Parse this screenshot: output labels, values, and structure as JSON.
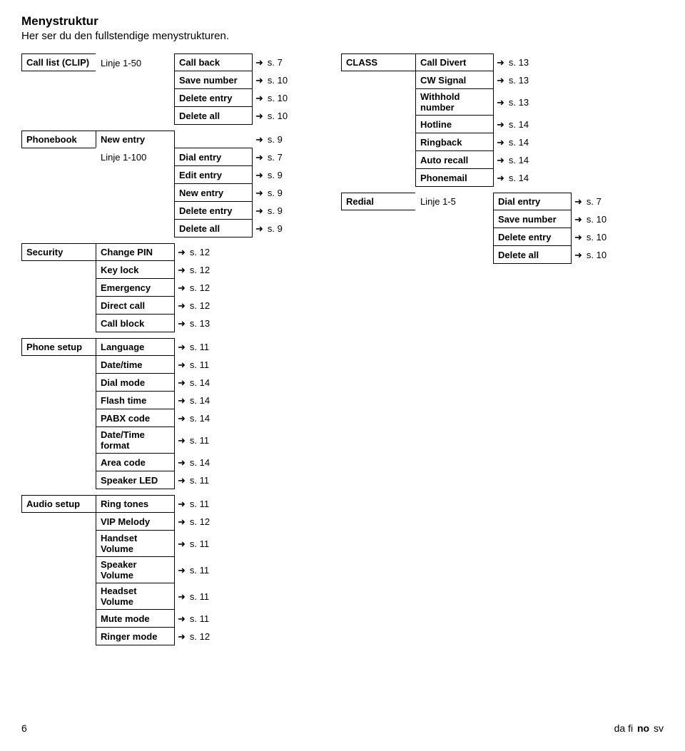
{
  "title": "Menystruktur",
  "subtitle": "Her ser du den fullstendige menystrukturen.",
  "arrow": "➜",
  "footer": {
    "page": "6",
    "lang_da": "da",
    "lang_fi": "fi",
    "lang_no": "no",
    "lang_sv": "sv"
  },
  "callList": {
    "label": "Call list (CLIP)",
    "range": "Linje 1-50",
    "items": [
      {
        "label": "Call back",
        "page": "s. 7"
      },
      {
        "label": "Save number",
        "page": "s. 10"
      },
      {
        "label": "Delete entry",
        "page": "s. 10"
      },
      {
        "label": "Delete all",
        "page": "s. 10"
      }
    ]
  },
  "phonebook": {
    "label": "Phonebook",
    "newEntry": {
      "label": "New entry",
      "page": "s. 9"
    },
    "range": "Linje 1-100",
    "subItems": [
      {
        "label": "Dial entry",
        "page": "s. 7"
      },
      {
        "label": "Edit entry",
        "page": "s. 9"
      },
      {
        "label": "New entry",
        "page": "s. 9"
      },
      {
        "label": "Delete entry",
        "page": "s. 9"
      },
      {
        "label": "Delete all",
        "page": "s. 9"
      }
    ]
  },
  "security": {
    "label": "Security",
    "items": [
      {
        "label": "Change PIN",
        "page": "s. 12"
      },
      {
        "label": "Key lock",
        "page": "s. 12"
      },
      {
        "label": "Emergency",
        "page": "s. 12"
      },
      {
        "label": "Direct call",
        "page": "s. 12"
      },
      {
        "label": "Call block",
        "page": "s. 13"
      }
    ]
  },
  "phoneSetup": {
    "label": "Phone setup",
    "items": [
      {
        "label": "Language",
        "page": "s. 11"
      },
      {
        "label": "Date/time",
        "page": "s. 11"
      },
      {
        "label": "Dial mode",
        "page": "s. 14"
      },
      {
        "label": "Flash time",
        "page": "s. 14"
      },
      {
        "label": "PABX code",
        "page": "s. 14"
      },
      {
        "label": "Date/Time format",
        "page": "s. 11"
      },
      {
        "label": "Area code",
        "page": "s. 14"
      },
      {
        "label": "Speaker LED",
        "page": "s. 11"
      }
    ]
  },
  "audioSetup": {
    "label": "Audio setup",
    "items": [
      {
        "label": "Ring tones",
        "page": "s. 11"
      },
      {
        "label": "VIP Melody",
        "page": "s. 12"
      },
      {
        "label": "Handset Volume",
        "page": "s. 11"
      },
      {
        "label": "Speaker Volume",
        "page": "s. 11"
      },
      {
        "label": "Headset Volume",
        "page": "s. 11"
      },
      {
        "label": "Mute mode",
        "page": "s. 11"
      },
      {
        "label": "Ringer mode",
        "page": "s. 12"
      }
    ]
  },
  "classMenu": {
    "label": "CLASS",
    "items": [
      {
        "label": "Call Divert",
        "page": "s. 13"
      },
      {
        "label": "CW Signal",
        "page": "s. 13"
      },
      {
        "label": "Withhold number",
        "page": "s. 13"
      },
      {
        "label": "Hotline",
        "page": "s. 14"
      },
      {
        "label": "Ringback",
        "page": "s. 14"
      },
      {
        "label": "Auto recall",
        "page": "s. 14"
      },
      {
        "label": "Phonemail",
        "page": "s. 14"
      }
    ]
  },
  "redial": {
    "label": "Redial",
    "range": "Linje 1-5",
    "items": [
      {
        "label": "Dial entry",
        "page": "s. 7"
      },
      {
        "label": "Save number",
        "page": "s. 10"
      },
      {
        "label": "Delete entry",
        "page": "s. 10"
      },
      {
        "label": "Delete all",
        "page": "s. 10"
      }
    ]
  }
}
